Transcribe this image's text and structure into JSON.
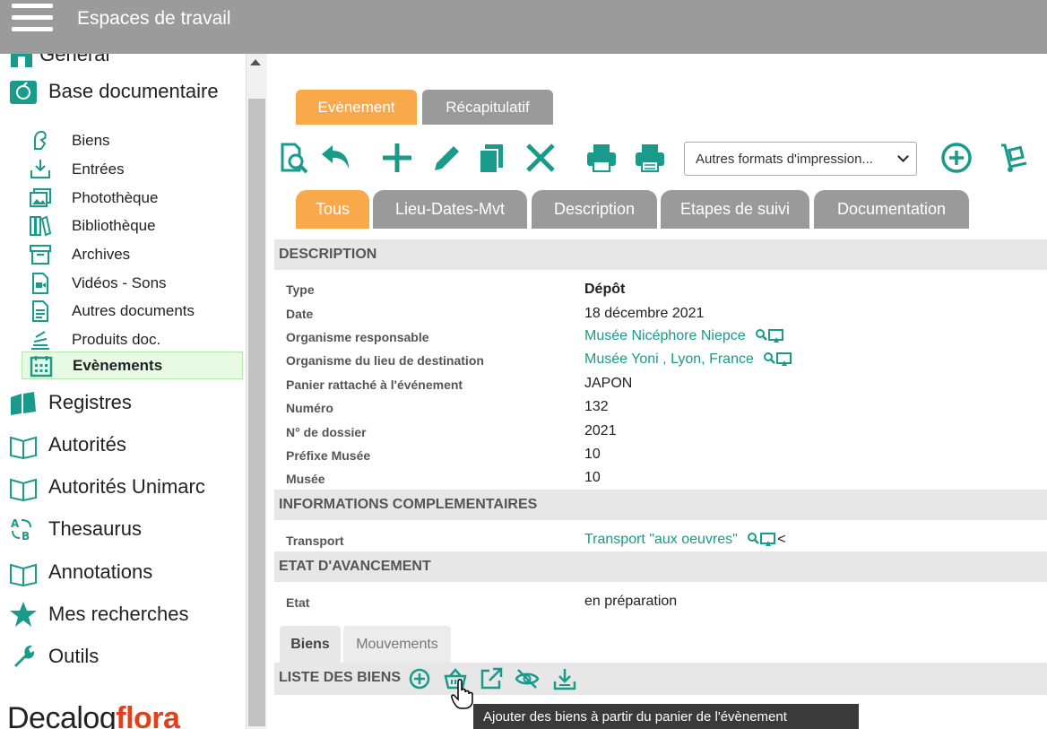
{
  "topbar": {
    "title": "Espaces de travail"
  },
  "sidebar": {
    "top_partial": "Général",
    "sections": [
      {
        "label": "Base documentaire",
        "icon": "database-icon"
      },
      {
        "label": "Registres",
        "icon": "books-icon"
      },
      {
        "label": "Autorités",
        "icon": "open-book-icon"
      },
      {
        "label": "Autorités Unimarc",
        "icon": "open-book-icon"
      },
      {
        "label": "Thesaurus",
        "icon": "thesaurus-icon"
      },
      {
        "label": "Annotations",
        "icon": "open-book-icon"
      },
      {
        "label": "Mes recherches",
        "icon": "star-icon"
      },
      {
        "label": "Outils",
        "icon": "wrench-icon"
      }
    ],
    "sub_items": [
      {
        "label": "Biens",
        "icon": "object-icon"
      },
      {
        "label": "Entrées",
        "icon": "inbox-icon"
      },
      {
        "label": "Photothèque",
        "icon": "photos-icon"
      },
      {
        "label": "Bibliothèque",
        "icon": "library-icon"
      },
      {
        "label": "Archives",
        "icon": "archive-icon"
      },
      {
        "label": "Vidéos - Sons",
        "icon": "video-icon"
      },
      {
        "label": "Autres documents",
        "icon": "document-icon"
      },
      {
        "label": "Produits doc.",
        "icon": "stack-icon"
      },
      {
        "label": "Evènements",
        "icon": "calendar-icon",
        "active": true
      }
    ],
    "logo": {
      "part1": "Decalog",
      "part2": "flora"
    }
  },
  "main": {
    "top_tabs": [
      "Evènement",
      "Récapitulatif"
    ],
    "print_select": "Autres formats d'impression...",
    "sub_tabs": [
      "Tous",
      "Lieu-Dates-Mvt",
      "Description",
      "Etapes de suivi",
      "Documentation"
    ],
    "description": {
      "header": "DESCRIPTION",
      "rows": [
        {
          "label": "Type",
          "value": "Dépôt"
        },
        {
          "label": "Date",
          "value": "18 décembre 2021"
        },
        {
          "label": "Organisme responsable",
          "value": "Musée Nicéphore Niepce"
        },
        {
          "label": "Organisme du lieu de destination",
          "value": "Musée Yoni , Lyon, France"
        },
        {
          "label": "Panier rattaché à l'événement",
          "value": "JAPON"
        },
        {
          "label": "Numéro",
          "value": "132"
        },
        {
          "label": "N° de dossier",
          "value": "2021"
        },
        {
          "label": "Préfixe Musée",
          "value": "10"
        },
        {
          "label": "Musée",
          "value": "10"
        }
      ]
    },
    "complementaires": {
      "header": "INFORMATIONS COMPLEMENTAIRES",
      "label": "Transport",
      "value": "Transport \"aux oeuvres\"",
      "suffix": "<"
    },
    "avancement": {
      "header": "ETAT D'AVANCEMENT",
      "label": "Etat",
      "value": "en préparation"
    },
    "bottom_tabs": [
      "Biens",
      "Mouvements"
    ],
    "list_header": "LISTE DES BIENS",
    "tooltip": "Ajouter des biens à partir du panier de l'évènement"
  },
  "colors": {
    "accent": "#1a9a8a",
    "orange": "#f9a84a",
    "grey_tab": "#9a9a9a",
    "topbar": "#9b9b9b"
  }
}
